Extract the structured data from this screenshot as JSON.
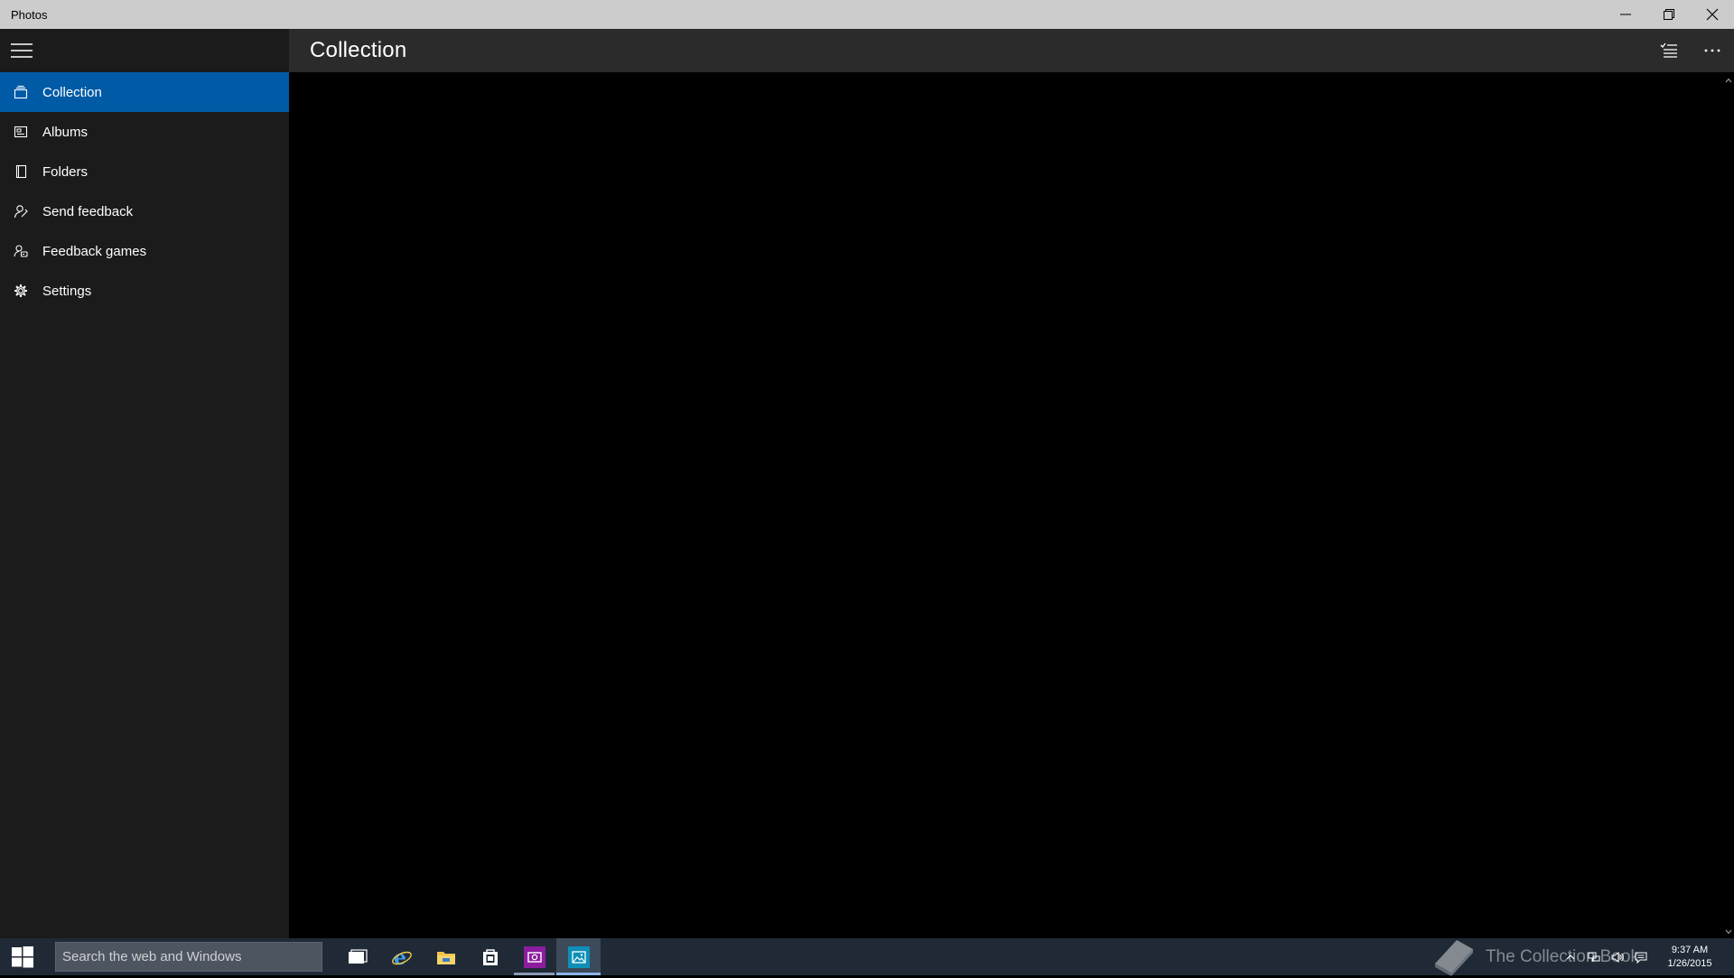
{
  "window": {
    "title": "Photos"
  },
  "header": {
    "page_title": "Collection"
  },
  "sidebar": {
    "items": [
      {
        "label": "Collection",
        "icon": "collection-icon",
        "selected": true
      },
      {
        "label": "Albums",
        "icon": "albums-icon"
      },
      {
        "label": "Folders",
        "icon": "folder-icon"
      },
      {
        "label": "Send feedback",
        "icon": "feedback-icon"
      },
      {
        "label": "Feedback games",
        "icon": "feedback-games-icon"
      },
      {
        "label": "Settings",
        "icon": "gear-icon"
      }
    ]
  },
  "taskbar": {
    "search_placeholder": "Search the web and Windows",
    "clock_time": "9:37 AM",
    "clock_date": "1/26/2015",
    "watermark": "The Collection Book"
  },
  "colors": {
    "accent": "#005aa6",
    "sidebar_bg": "#1b1b1b",
    "header_bg": "#2b2b2b",
    "taskbar_bg": "#1f2a36"
  }
}
